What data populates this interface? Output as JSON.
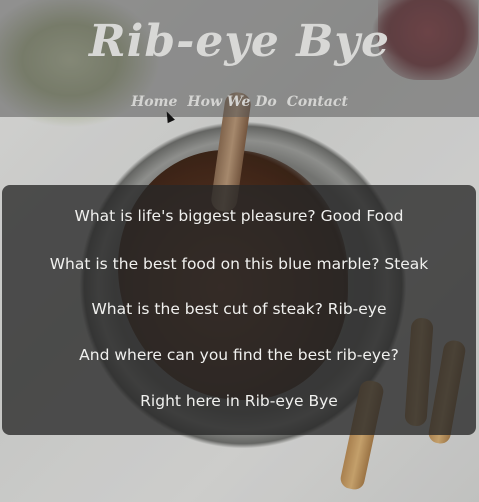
{
  "site": {
    "title": "Rib-eye Bye"
  },
  "nav": {
    "items": [
      "Home",
      "How We Do",
      "Contact"
    ]
  },
  "content": {
    "lines": [
      "What is life's biggest pleasure? Good Food",
      "What is the best food on this blue marble? Steak",
      "What is the best cut of steak? Rib-eye",
      "And where can you find the best rib-eye?",
      "Right here in Rib-eye Bye"
    ]
  },
  "colors": {
    "header_overlay": "#5a5a5a",
    "content_overlay": "#282828",
    "text": "#f0f0ee"
  }
}
